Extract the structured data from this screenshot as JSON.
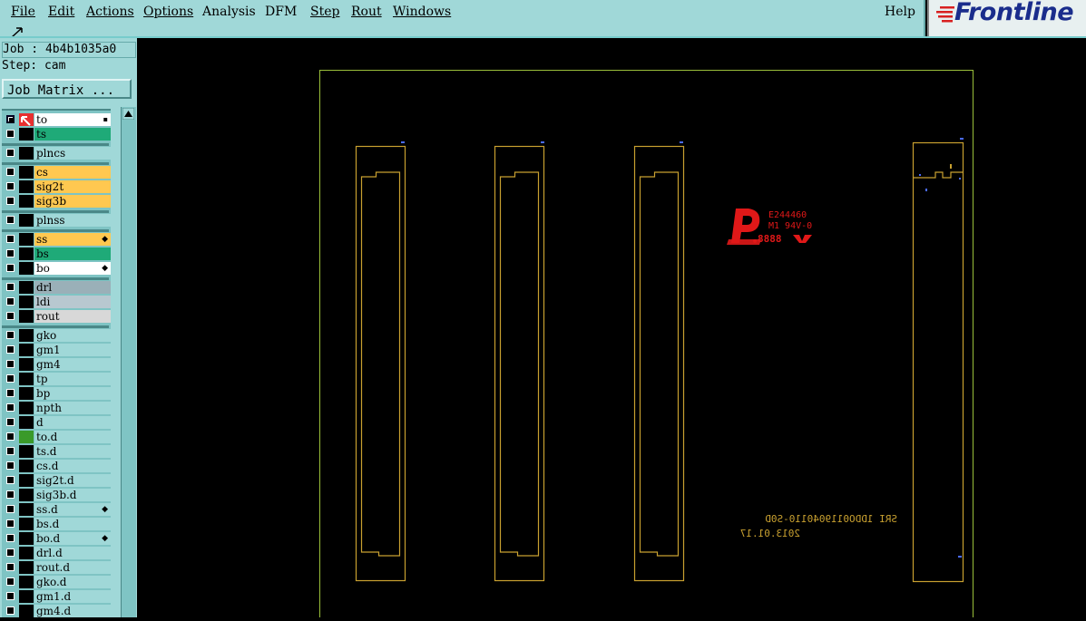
{
  "menu": {
    "items": [
      "File",
      "Edit",
      "Actions",
      "Options",
      "Analysis",
      "DFM",
      "Step",
      "Rout",
      "Windows"
    ],
    "help": "Help"
  },
  "logo": {
    "text": "Frontline"
  },
  "job": {
    "job_label": "Job : 4b4b1035a0",
    "step_label": "Step: cam",
    "matrix_button": "Job Matrix ..."
  },
  "layers": [
    {
      "name": "to",
      "color": "#ffffff",
      "active": true
    },
    {
      "name": "ts",
      "color": "#1faa78"
    },
    {
      "name": "plncs",
      "color": "#a0d8d8"
    },
    {
      "name": "cs",
      "color": "#ffc850"
    },
    {
      "name": "sig2t",
      "color": "#ffc850"
    },
    {
      "name": "sig3b",
      "color": "#ffc850"
    },
    {
      "name": "plnss",
      "color": "#a0d8d8"
    },
    {
      "name": "ss",
      "color": "#ffc850",
      "mark": "◆"
    },
    {
      "name": "bs",
      "color": "#1faa78"
    },
    {
      "name": "bo",
      "color": "#ffffff",
      "mark": "◆"
    },
    {
      "name": "drl",
      "color": "#9ab0b8"
    },
    {
      "name": "ldi",
      "color": "#b8c8d0"
    },
    {
      "name": "rout",
      "color": "#d8d8d8"
    },
    {
      "name": "gko",
      "color": "#a0d8d8"
    },
    {
      "name": "gm1",
      "color": "#a0d8d8"
    },
    {
      "name": "gm4",
      "color": "#a0d8d8"
    },
    {
      "name": "tp",
      "color": "#a0d8d8"
    },
    {
      "name": "bp",
      "color": "#a0d8d8"
    },
    {
      "name": "npth",
      "color": "#a0d8d8"
    },
    {
      "name": "d",
      "color": "#a0d8d8"
    },
    {
      "name": "to.d",
      "color": "#a0d8d8"
    },
    {
      "name": "ts.d",
      "color": "#a0d8d8"
    },
    {
      "name": "cs.d",
      "color": "#a0d8d8"
    },
    {
      "name": "sig2t.d",
      "color": "#a0d8d8"
    },
    {
      "name": "sig3b.d",
      "color": "#a0d8d8"
    },
    {
      "name": "ss.d",
      "color": "#a0d8d8",
      "mark": "◆"
    },
    {
      "name": "bs.d",
      "color": "#a0d8d8"
    },
    {
      "name": "bo.d",
      "color": "#a0d8d8",
      "mark": "◆"
    },
    {
      "name": "drl.d",
      "color": "#a0d8d8"
    },
    {
      "name": "rout.d",
      "color": "#a0d8d8"
    },
    {
      "name": "gko.d",
      "color": "#a0d8d8"
    },
    {
      "name": "gm1.d",
      "color": "#a0d8d8"
    },
    {
      "name": "gm4.d",
      "color": "#a0d8d8"
    }
  ],
  "canvas": {
    "ul_mark": {
      "line1": "E244460",
      "line2": "M1 94V-0",
      "line3": "8888"
    },
    "date_text": {
      "line1": "SRI 1DDO0119040110-S0D",
      "line2": "2013.01.17"
    }
  },
  "colors": {
    "outline": "#c8a030",
    "board": "#9abf3a",
    "ul_logo": "#e01818",
    "panel": "#a0d8d8"
  }
}
